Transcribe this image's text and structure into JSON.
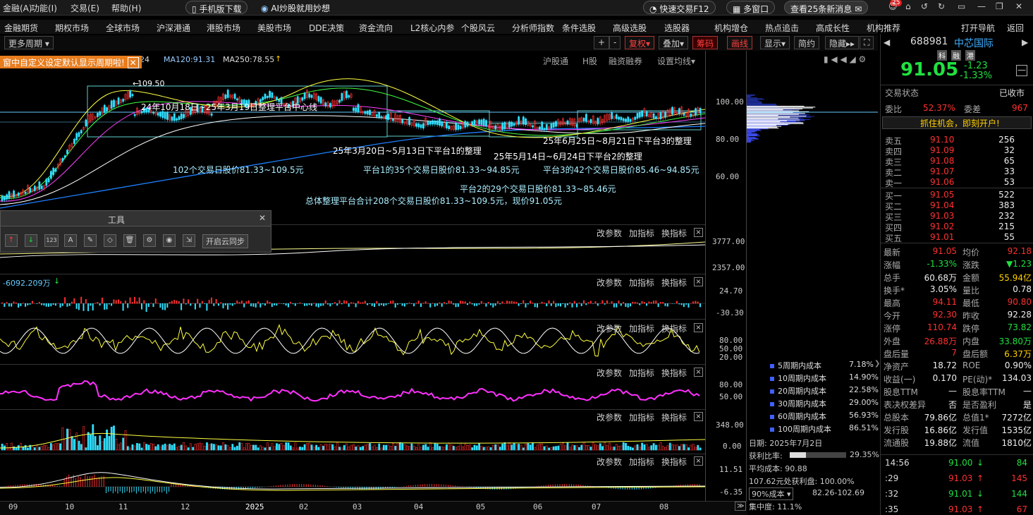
{
  "menu": {
    "items": [
      "金融(A)",
      "功能(I)",
      "交易(E)",
      "帮助(H)"
    ],
    "mobile": "手机版下载",
    "ai": "AI炒股就用妙想",
    "quicktrade": "快速交易F12",
    "multiwin": "多窗口",
    "news": "查看25条新消息",
    "badge": "25"
  },
  "nav": {
    "items": [
      "金融期货",
      "期权市场",
      "全球市场",
      "沪深港通",
      "港股市场",
      "美股市场",
      "DDE决策",
      "资金流向",
      "L2核心内参",
      "个股风云",
      "分析师指数",
      "条件选股",
      "高级选股",
      "选股器",
      "机构增仓",
      "热点追击",
      "高成长性",
      "机构推荐"
    ],
    "open": "打开导航",
    "back": "返回"
  },
  "toolbar": {
    "period": "更多周期",
    "ma_text": "24",
    "ma120": "MA120:91.31",
    "ma250": "MA250:78.55",
    "up_arrow": "↑",
    "btns": [
      "+",
      "-",
      "复权",
      "叠加",
      "筹码",
      "画线",
      "显示",
      "简约",
      "隐藏"
    ],
    "hgt": "沪股通",
    "h": "H股",
    "rzrq": "融资融券",
    "ma_set": "设置均线"
  },
  "tooltip": "窗中自定义设定默认显示周期啦!",
  "axes": {
    "price": [
      "100.00",
      "80.00",
      "60.00"
    ],
    "vol1": [
      "3777.00",
      "2357.00"
    ],
    "flow": [
      "24.70",
      "-30.30"
    ],
    "kdj": [
      "80.00",
      "50.00",
      "20.00"
    ],
    "rsi": [
      "80.00",
      "50.00"
    ],
    "vol2": [
      "348.00",
      "0.00"
    ],
    "macd": [
      "11.51",
      "-6.35"
    ],
    "months": [
      "09",
      "10",
      "11",
      "12",
      "2025",
      "02",
      "03",
      "04",
      "05",
      "06",
      "07",
      "08"
    ]
  },
  "chart": {
    "high": "109.50",
    "annotations": [
      "24年10月18日~25年3月19日整理平台中心线",
      "25年3月20日~5月13日下平台1的整理",
      "25年5月14日~6月24日下平台2的整理",
      "25年6月25日~8月21日下平台3的整理",
      "102个交易日股价81.33~109.5元",
      "平台1的35个交易日股价81.33~94.85元",
      "平台3的42个交易日股价85.46~94.85元",
      "平台2的29个交易日股价81.33~85.46元",
      "总体整理平台合计208个交易日股价81.33~109.5元，现价91.05元"
    ],
    "flow_label": "-6092.209万"
  },
  "panel_ctrl": {
    "a": "改参数",
    "b": "加指标",
    "c": "换指标",
    "x": "×"
  },
  "toolwin": {
    "title": "工具",
    "sync": "开启云同步",
    "icons": [
      "↑",
      "↓",
      "123",
      "A",
      "✎",
      "◇",
      "🗑",
      "⚙",
      "◉",
      "⇲"
    ]
  },
  "chip": {
    "legend": [
      {
        "n": "5周期内成本",
        "v": "7.18%"
      },
      {
        "n": "10周期内成本",
        "v": "14.90%"
      },
      {
        "n": "20周期内成本",
        "v": "22.58%"
      },
      {
        "n": "30周期内成本",
        "v": "29.00%"
      },
      {
        "n": "60周期内成本",
        "v": "56.93%"
      },
      {
        "n": "100周期内成本",
        "v": "86.51%"
      }
    ],
    "date": "日期: 2025年7月2日",
    "profit_label": "获利比率:",
    "profit": "29.35%",
    "avg": "平均成本: 90.88",
    "profit_line": "107.62元处获利盘: 100.00%",
    "cost_sel": "90%成本",
    "cost_range": "82.26-102.69",
    "conc": "集中度: 11.1%"
  },
  "stock": {
    "code": "688981",
    "name": "中芯国际",
    "tags": [
      "科",
      "融",
      "港"
    ],
    "price": "91.05",
    "chg": "-1.23",
    "pct": "-1.33%",
    "state_label": "交易状态",
    "state": "已收市",
    "wb_label": "委比",
    "wb": "52.37%",
    "wc_label": "委差",
    "wc": "967",
    "banner": "抓住机会，即刻开户!"
  },
  "asks": [
    {
      "l": "卖五",
      "p": "91.10",
      "v": "256"
    },
    {
      "l": "卖四",
      "p": "91.09",
      "v": "32"
    },
    {
      "l": "卖三",
      "p": "91.08",
      "v": "65"
    },
    {
      "l": "卖二",
      "p": "91.07",
      "v": "33"
    },
    {
      "l": "卖一",
      "p": "91.06",
      "v": "53"
    }
  ],
  "bids": [
    {
      "l": "买一",
      "p": "91.05",
      "v": "522"
    },
    {
      "l": "买二",
      "p": "91.04",
      "v": "383"
    },
    {
      "l": "买三",
      "p": "91.03",
      "v": "232"
    },
    {
      "l": "买四",
      "p": "91.02",
      "v": "215"
    },
    {
      "l": "买五",
      "p": "91.01",
      "v": "55"
    }
  ],
  "stats": [
    {
      "a": "最新",
      "b": "91.05",
      "c": "均价",
      "d": "92.18"
    },
    {
      "a": "涨幅",
      "b": "-1.33%",
      "c": "涨跌",
      "d": "▼1.23"
    },
    {
      "a": "总手",
      "b": "60.68万",
      "c": "金额",
      "d": "55.94亿"
    },
    {
      "a": "换手*",
      "b": "3.05%",
      "c": "量比",
      "d": "0.78"
    },
    {
      "a": "最高",
      "b": "94.11",
      "c": "最低",
      "d": "90.80"
    },
    {
      "a": "今开",
      "b": "92.30",
      "c": "昨收",
      "d": "92.28"
    },
    {
      "a": "涨停",
      "b": "110.74",
      "c": "跌停",
      "d": "73.82"
    },
    {
      "a": "外盘",
      "b": "26.88万",
      "c": "内盘",
      "d": "33.80万"
    },
    {
      "a": "盘后量",
      "b": "7",
      "c": "盘后额",
      "d": "6.37万"
    },
    {
      "a": "净资产",
      "b": "18.72",
      "c": "ROE",
      "d": "0.90%"
    },
    {
      "a": "收益(一)",
      "b": "0.170",
      "c": "PE(动)*",
      "d": "134.03"
    },
    {
      "a": "股息TTM",
      "b": "—",
      "c": "股息率TTM",
      "d": "—"
    },
    {
      "a": "表决权差异",
      "b": "否",
      "c": "是否盈利",
      "d": "是"
    },
    {
      "a": "总股本",
      "b": "79.86亿",
      "c": "总值1*",
      "d": "7272亿"
    },
    {
      "a": "发行股",
      "b": "16.86亿",
      "c": "发行值",
      "d": "1535亿"
    },
    {
      "a": "流通股",
      "b": "19.88亿",
      "c": "流值",
      "d": "1810亿"
    }
  ],
  "ticks": [
    {
      "t": "14:56",
      "p": "91.00",
      "a": "↓",
      "v": "84"
    },
    {
      "t": ":29",
      "p": "91.03",
      "a": "↑",
      "v": "145"
    },
    {
      "t": ":32",
      "p": "91.01",
      "a": "↓",
      "v": "144"
    },
    {
      "t": ":35",
      "p": "91.03",
      "a": "↑",
      "v": "67"
    }
  ]
}
